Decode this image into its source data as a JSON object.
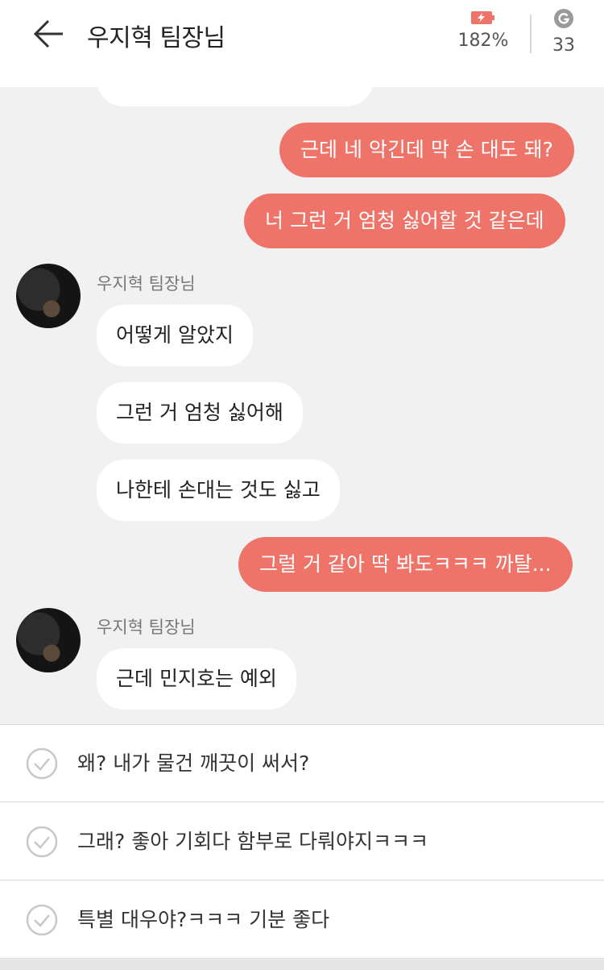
{
  "header": {
    "title": "우지혁 팀장님",
    "battery_text": "182%",
    "gem_count": "33",
    "accent_color": "#ee7369",
    "back_icon": "arrow-left-icon",
    "battery_icon": "battery-charging-icon",
    "gem_icon": "g-coin-icon"
  },
  "messages": {
    "out1": "근데 네 악긴데 막 손 대도 돼?",
    "out2": "너 그런 거 엄청 싫어할 것 같은데",
    "sender1": "우지혁 팀장님",
    "in1": "어떻게 알았지",
    "in2": "그런 거 엄청 싫어해",
    "in3": "나한테 손대는 것도 싫고",
    "out3": "그럴 거 같아 딱 봐도ㅋㅋㅋ 까탈...",
    "sender2": "우지혁 팀장님",
    "in4": "근데 민지호는 예외"
  },
  "options": [
    {
      "text": "왜? 내가 물건 깨끗이 써서?"
    },
    {
      "text": "그래? 좋아 기회다 함부로 다뤄야지ㅋㅋㅋ"
    },
    {
      "text": "특별 대우야?ㅋㅋㅋ 기분 좋다"
    }
  ]
}
